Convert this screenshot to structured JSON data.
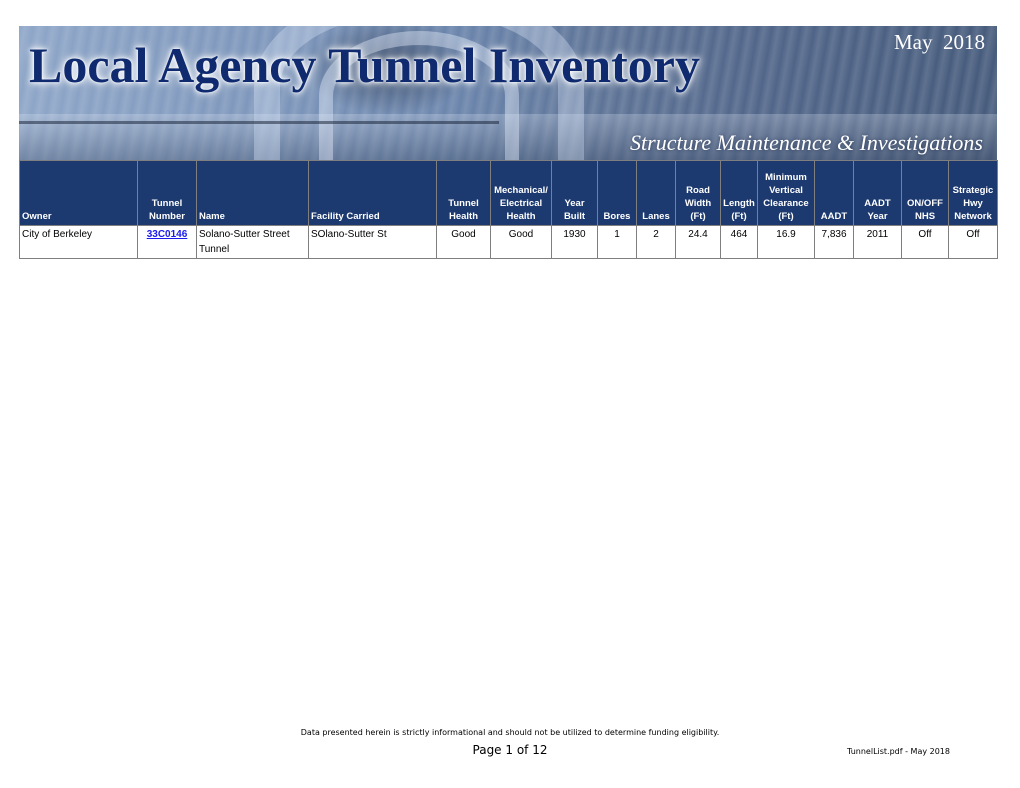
{
  "header": {
    "title": "Local Agency Tunnel Inventory",
    "date": "May  2018",
    "subtitle": "Structure Maintenance & Investigations"
  },
  "colors": {
    "header_bg": "#1d3a70",
    "title_text": "#0f2a6e",
    "link": "#1a1aee",
    "border": "#7f7f7f"
  },
  "table": {
    "columns": [
      {
        "key": "owner",
        "label": "Owner"
      },
      {
        "key": "tunnel_number",
        "label": "Tunnel\nNumber"
      },
      {
        "key": "name",
        "label": "Name"
      },
      {
        "key": "facility_carried",
        "label": "Facility Carried"
      },
      {
        "key": "tunnel_health",
        "label": "Tunnel\nHealth"
      },
      {
        "key": "mech_elec_health",
        "label": "Mechanical/\nElectrical\nHealth"
      },
      {
        "key": "year_built",
        "label": "Year Built"
      },
      {
        "key": "bores",
        "label": "Bores"
      },
      {
        "key": "lanes",
        "label": "Lanes"
      },
      {
        "key": "road_width",
        "label": "Road\nWidth (Ft)"
      },
      {
        "key": "length",
        "label": "Length\n(Ft)"
      },
      {
        "key": "min_vert_clearance",
        "label": "Minimum\nVertical\nClearance\n(Ft)"
      },
      {
        "key": "aadt",
        "label": "AADT"
      },
      {
        "key": "aadt_year",
        "label": "AADT\nYear"
      },
      {
        "key": "nhs",
        "label": "ON/OFF\nNHS"
      },
      {
        "key": "strategic_hwy",
        "label": "Strategic\nHwy\nNetwork"
      }
    ],
    "rows": [
      {
        "owner": "City of Berkeley",
        "tunnel_number": "33C0146",
        "name": "Solano-Sutter Street Tunnel",
        "facility_carried": "SOlano-Sutter St",
        "tunnel_health": "Good",
        "mech_elec_health": "Good",
        "year_built": "1930",
        "bores": "1",
        "lanes": "2",
        "road_width": "24.4",
        "length": "464",
        "min_vert_clearance": "16.9",
        "aadt": "7,836",
        "aadt_year": "2011",
        "nhs": "Off",
        "strategic_hwy": "Off"
      }
    ]
  },
  "footer": {
    "disclaimer": "Data presented herein is strictly informational and should not be utilized to determine funding eligibility.",
    "page": "Page 1 of 12",
    "file_label": "TunnelList.pdf - May 2018"
  }
}
